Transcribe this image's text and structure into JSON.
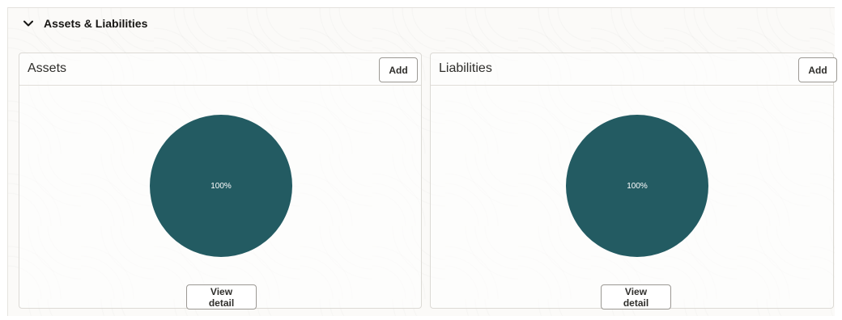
{
  "section": {
    "title": "Assets & Liabilities",
    "expand_icon": "chevron-down-icon"
  },
  "assets": {
    "title": "Assets",
    "add_label": "Add",
    "pie_label": "100%",
    "view_label": "View detail"
  },
  "liabilities": {
    "title": "Liabilities",
    "add_label": "Add",
    "pie_label": "100%",
    "view_label": "View detail"
  },
  "colors": {
    "pie_fill": "#235b62"
  },
  "chart_data": [
    {
      "type": "pie",
      "categories": [
        ""
      ],
      "values": [
        100
      ],
      "data_labels": [
        "100%"
      ]
    },
    {
      "type": "pie",
      "categories": [
        ""
      ],
      "values": [
        100
      ],
      "data_labels": [
        "100%"
      ]
    }
  ]
}
